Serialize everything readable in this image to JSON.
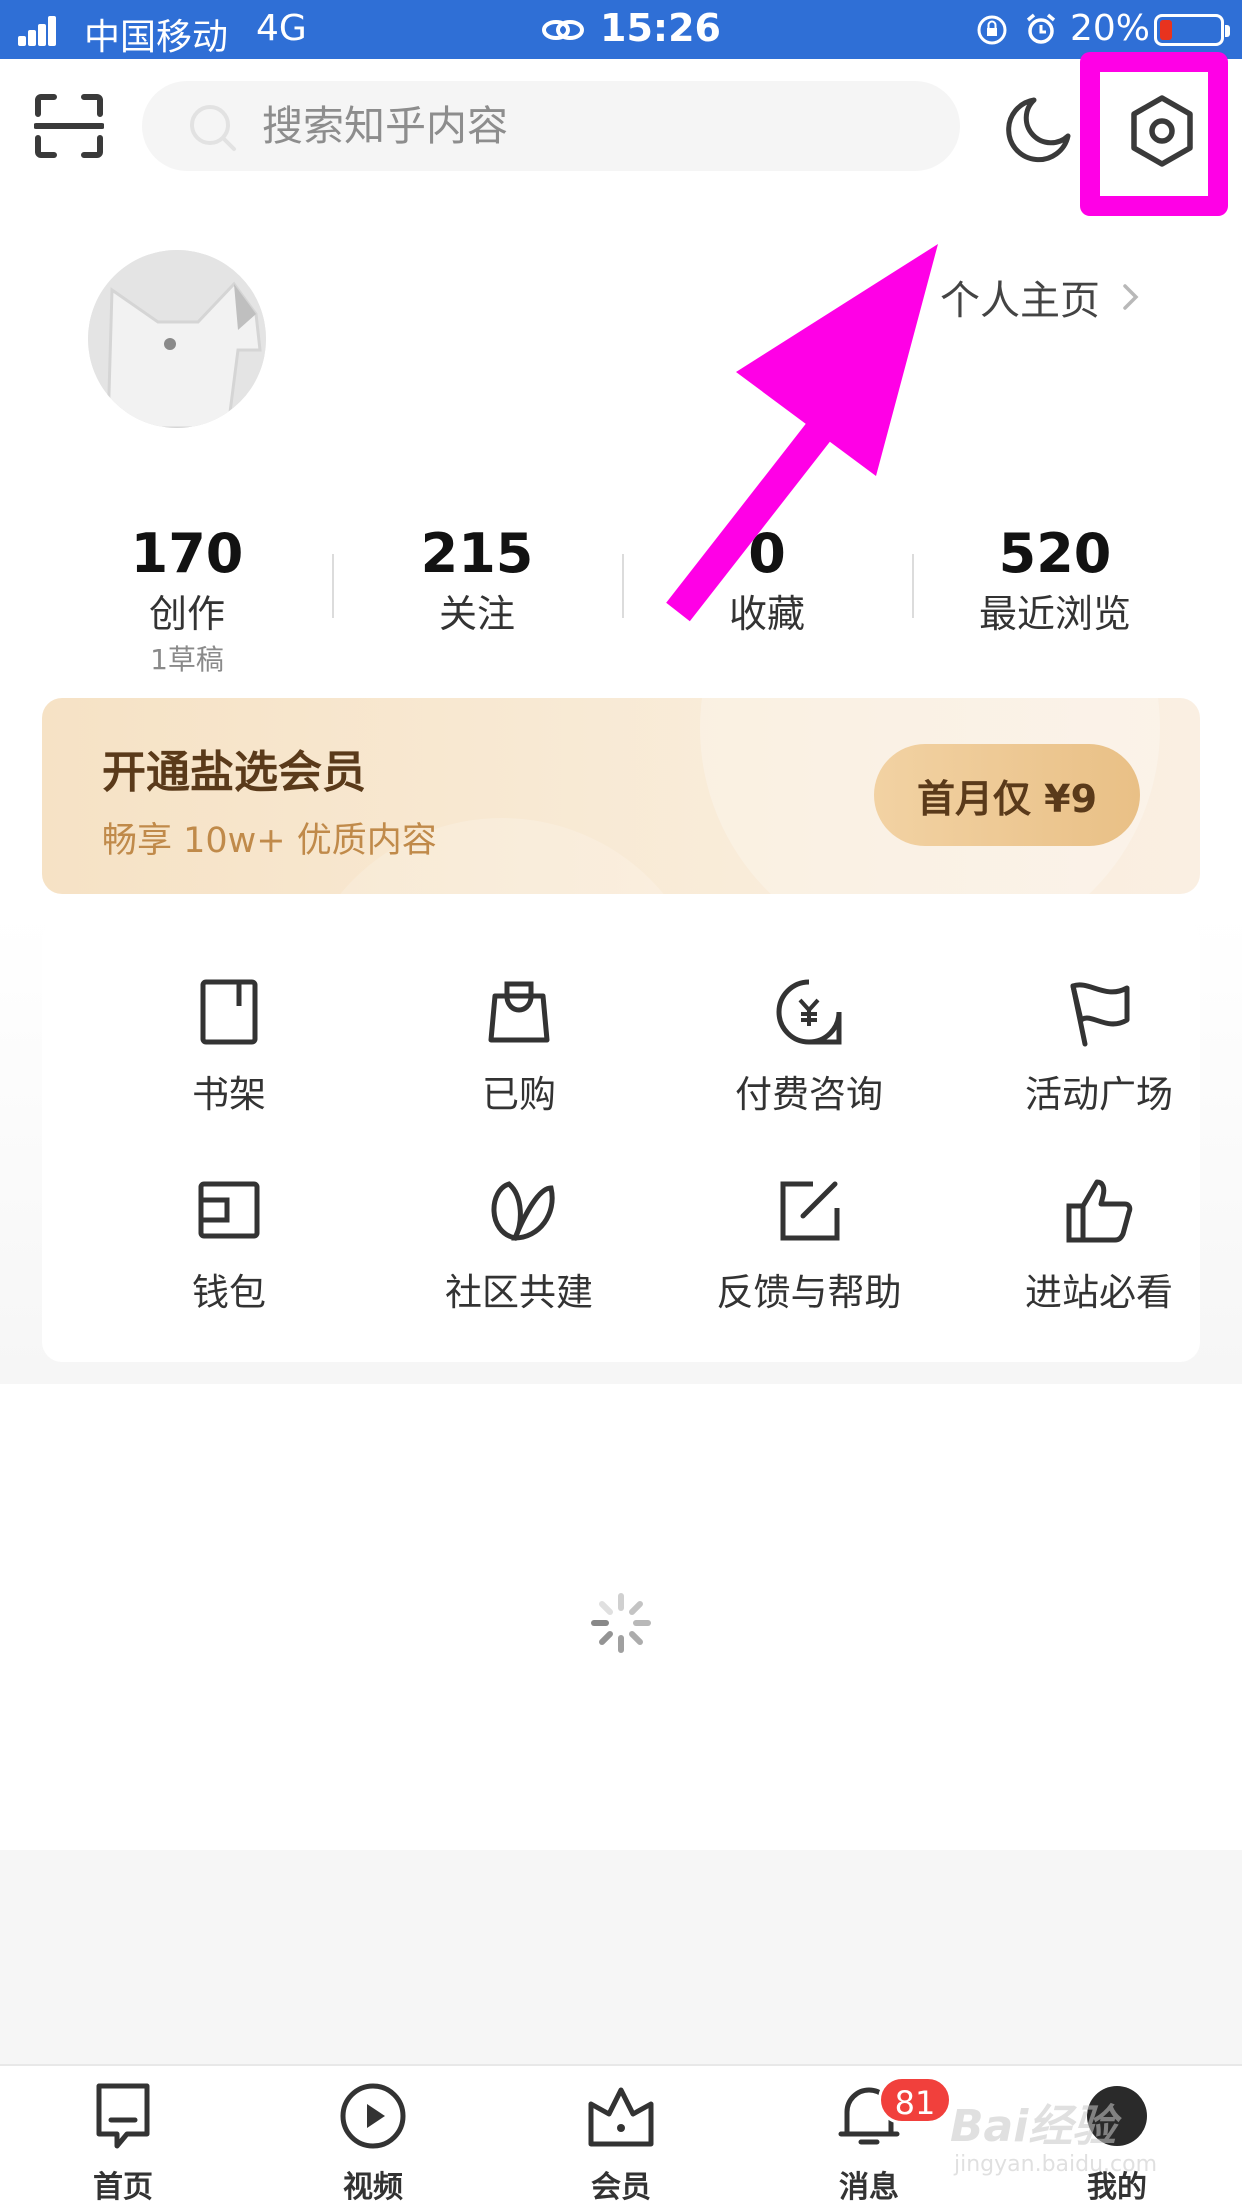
{
  "status_bar": {
    "carrier": "中国移动",
    "network": "4G",
    "time": "15:26",
    "battery_percent": "20%",
    "battery_level": 0.2,
    "battery_color": "#e8331e",
    "background": "#2f6fd6"
  },
  "top_bar": {
    "search_placeholder": "搜索知乎内容",
    "icons": [
      "scan-icon",
      "search-icon",
      "moon-icon",
      "settings-gear-icon"
    ]
  },
  "annotation": {
    "highlight_color": "#ff00e6",
    "target": "settings-gear-icon"
  },
  "profile": {
    "homepage_link": "个人主页"
  },
  "stats": [
    {
      "value": "170",
      "label": "创作",
      "sub": "1草稿"
    },
    {
      "value": "215",
      "label": "关注",
      "sub": ""
    },
    {
      "value": "0",
      "label": "收藏",
      "sub": ""
    },
    {
      "value": "520",
      "label": "最近浏览",
      "sub": ""
    }
  ],
  "vip": {
    "title": "开通盐选会员",
    "subtitle": "畅享 10w+ 优质内容",
    "button": "首月仅 ¥9"
  },
  "grid": [
    {
      "label": "书架",
      "icon": "bookshelf-icon"
    },
    {
      "label": "已购",
      "icon": "shopping-bag-icon"
    },
    {
      "label": "付费咨询",
      "icon": "paid-consult-icon"
    },
    {
      "label": "活动广场",
      "icon": "flag-icon"
    },
    {
      "label": "钱包",
      "icon": "wallet-icon"
    },
    {
      "label": "社区共建",
      "icon": "leaves-icon"
    },
    {
      "label": "反馈与帮助",
      "icon": "edit-feedback-icon"
    },
    {
      "label": "进站必看",
      "icon": "thumbs-up-icon"
    }
  ],
  "tabs": [
    {
      "label": "首页",
      "icon": "home-icon"
    },
    {
      "label": "视频",
      "icon": "video-play-icon"
    },
    {
      "label": "会员",
      "icon": "crown-icon"
    },
    {
      "label": "消息",
      "icon": "bell-icon",
      "badge": "81"
    },
    {
      "label": "我的",
      "icon": "me-avatar-icon"
    }
  ],
  "watermark": {
    "brand": "Bai经验",
    "url": "jingyan.baidu.com"
  }
}
